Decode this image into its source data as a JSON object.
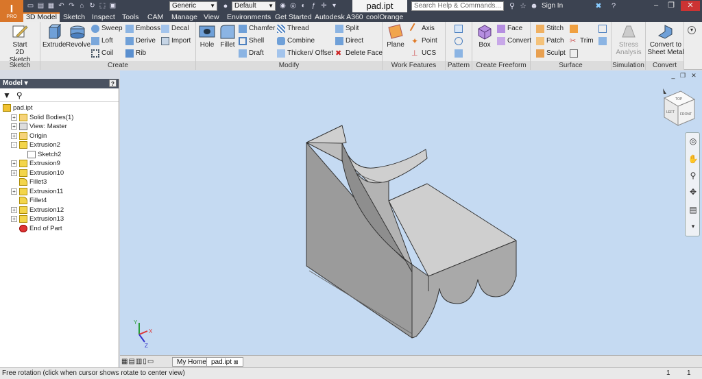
{
  "app": {
    "logo_letter": "I",
    "logo_sub": "PRO"
  },
  "titlebar": {
    "material": "Generic",
    "appearance": "Default",
    "document_title": "pad.ipt",
    "search_placeholder": "Search Help & Commands...",
    "sign_in": "Sign In"
  },
  "tabs": [
    "3D Model",
    "Sketch",
    "Inspect",
    "Tools",
    "CAM",
    "Manage",
    "View",
    "Environments",
    "Get Started",
    "Autodesk A360",
    "coolOrange"
  ],
  "ribbon": {
    "panels": {
      "sketch": "Sketch",
      "create": "Create",
      "modify": "Modify",
      "work_features": "Work Features",
      "pattern": "Pattern",
      "create_freeform": "Create Freeform",
      "surface": "Surface",
      "simulation": "Simulation",
      "convert": "Convert"
    },
    "buttons": {
      "start_sketch_l1": "Start",
      "start_sketch_l2": "2D Sketch",
      "extrude": "Extrude",
      "revolve": "Revolve",
      "sweep": "Sweep",
      "loft": "Loft",
      "coil": "Coil",
      "emboss": "Emboss",
      "derive": "Derive",
      "rib": "Rib",
      "decal": "Decal",
      "import": "Import",
      "hole": "Hole",
      "fillet": "Fillet",
      "chamfer": "Chamfer",
      "shell": "Shell",
      "draft": "Draft",
      "thread": "Thread",
      "combine": "Combine",
      "thicken_offset": "Thicken/ Offset",
      "split": "Split",
      "direct": "Direct",
      "delete_face": "Delete Face",
      "plane": "Plane",
      "axis": "Axis",
      "point": "Point",
      "ucs": "UCS",
      "box": "Box",
      "face": "Face",
      "convert": "Convert",
      "stitch": "Stitch",
      "patch": "Patch",
      "sculpt": "Sculpt",
      "trim": "Trim",
      "stress_l1": "Stress",
      "stress_l2": "Analysis",
      "sheet_metal_l1": "Convert to",
      "sheet_metal_l2": "Sheet Metal"
    }
  },
  "browser": {
    "title": "Model",
    "help": "?",
    "tree": [
      {
        "label": "pad.ipt",
        "level": 0,
        "expander": "",
        "icon": "part-icon"
      },
      {
        "label": "Solid Bodies(1)",
        "level": 1,
        "expander": "+",
        "icon": "folder-icon"
      },
      {
        "label": "View: Master",
        "level": 1,
        "expander": "+",
        "icon": "view-icon"
      },
      {
        "label": "Origin",
        "level": 1,
        "expander": "+",
        "icon": "folder-icon"
      },
      {
        "label": "Extrusion2",
        "level": 1,
        "expander": "-",
        "icon": "extrusion-icon"
      },
      {
        "label": "Sketch2",
        "level": 2,
        "expander": "",
        "icon": "sketch-icon"
      },
      {
        "label": "Extrusion9",
        "level": 1,
        "expander": "+",
        "icon": "extrusion-icon"
      },
      {
        "label": "Extrusion10",
        "level": 1,
        "expander": "+",
        "icon": "extrusion-icon"
      },
      {
        "label": "Fillet3",
        "level": 1,
        "expander": "",
        "icon": "fillet-icon"
      },
      {
        "label": "Extrusion11",
        "level": 1,
        "expander": "+",
        "icon": "extrusion-icon"
      },
      {
        "label": "Fillet4",
        "level": 1,
        "expander": "",
        "icon": "fillet-icon"
      },
      {
        "label": "Extrusion12",
        "level": 1,
        "expander": "+",
        "icon": "extrusion-icon"
      },
      {
        "label": "Extrusion13",
        "level": 1,
        "expander": "+",
        "icon": "extrusion-icon"
      },
      {
        "label": "End of Part",
        "level": 1,
        "expander": "",
        "icon": "end-of-part-icon"
      }
    ]
  },
  "viewcube": {
    "top": "TOP",
    "left": "LEFT",
    "front": "FRONT"
  },
  "axis_triad": {
    "x": "X",
    "y": "Y",
    "z": "Z"
  },
  "doc_tabs": [
    "My Home",
    "pad.ipt"
  ],
  "status": {
    "message": "Free rotation (click when cursor shows rotate to center view)",
    "count1": "1",
    "count2": "1"
  },
  "colors": {
    "ribbon_bg": "#ededed",
    "titlebar_bg": "#3c4351",
    "viewport_bg": "#c5daf2",
    "accent": "#e07a26"
  }
}
